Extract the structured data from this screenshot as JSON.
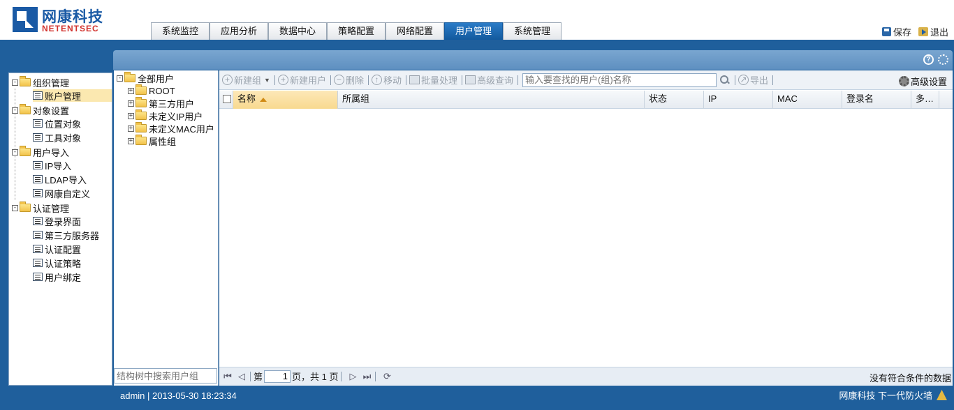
{
  "brand": {
    "cn": "网康科技",
    "en": "NETENTSEC"
  },
  "tabs": [
    {
      "label": "系统监控",
      "active": false
    },
    {
      "label": "应用分析",
      "active": false
    },
    {
      "label": "数据中心",
      "active": false
    },
    {
      "label": "策略配置",
      "active": false
    },
    {
      "label": "网络配置",
      "active": false
    },
    {
      "label": "用户管理",
      "active": true
    },
    {
      "label": "系统管理",
      "active": false
    }
  ],
  "header_actions": {
    "save": "保存",
    "exit": "退出"
  },
  "panel_icons": {
    "help": "help-icon",
    "settings": "gear-icon"
  },
  "nav": {
    "groups": [
      {
        "label": "组织管理",
        "items": [
          {
            "label": "账户管理",
            "selected": true
          }
        ]
      },
      {
        "label": "对象设置",
        "items": [
          {
            "label": "位置对象"
          },
          {
            "label": "工具对象"
          }
        ]
      },
      {
        "label": "用户导入",
        "items": [
          {
            "label": "IP导入"
          },
          {
            "label": "LDAP导入"
          },
          {
            "label": "网康自定义"
          }
        ]
      },
      {
        "label": "认证管理",
        "items": [
          {
            "label": "登录界面"
          },
          {
            "label": "第三方服务器"
          },
          {
            "label": "认证配置"
          },
          {
            "label": "认证策略"
          },
          {
            "label": "用户绑定"
          }
        ]
      }
    ]
  },
  "group_tree": {
    "root": "全部用户",
    "children": [
      "ROOT",
      "第三方用户",
      "未定义IP用户",
      "未定义MAC用户",
      "属性组"
    ],
    "search_placeholder": "结构树中搜索用户组"
  },
  "toolbar": {
    "new_group": "新建组",
    "new_user": "新建用户",
    "delete": "删除",
    "move": "移动",
    "batch": "批量处理",
    "advanced_query": "高级查询",
    "search_placeholder": "输入要查找的用户(组)名称",
    "export": "导出",
    "advanced_settings": "高级设置"
  },
  "grid": {
    "columns": [
      "名称",
      "所属组",
      "状态",
      "IP",
      "MAC",
      "登录名",
      "多…"
    ],
    "sorted_column": "名称",
    "rows": []
  },
  "pager": {
    "page_prefix": "第",
    "current_page": "1",
    "page_suffix": "页，共 1 页",
    "status": "没有符合条件的数据"
  },
  "status_bar": {
    "user_time": "admin | 2013-05-30 18:23:34",
    "product": "网康科技  下一代防火墙"
  }
}
